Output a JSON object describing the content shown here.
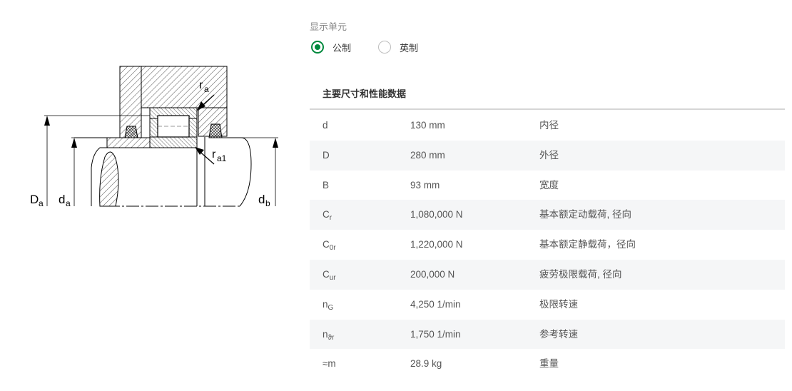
{
  "drawing": {
    "labels": {
      "Da_main": "D",
      "Da_sub": "a",
      "da_main": "d",
      "da_sub": "a",
      "db_main": "d",
      "db_sub": "b",
      "ra_main": "r",
      "ra_sub": "a",
      "ra1_main": "r",
      "ra1_sub": "a1"
    }
  },
  "units": {
    "heading": "显示单元",
    "options": [
      {
        "label": "公制",
        "selected": true
      },
      {
        "label": "英制",
        "selected": false
      }
    ],
    "accent_color": "#00893d"
  },
  "table": {
    "title": "主要尺寸和性能数据",
    "rows": [
      {
        "symbol": "d",
        "symbol_sub": "",
        "value": "130 mm",
        "desc": "内径"
      },
      {
        "symbol": "D",
        "symbol_sub": "",
        "value": "280 mm",
        "desc": "外径"
      },
      {
        "symbol": "B",
        "symbol_sub": "",
        "value": "93 mm",
        "desc": "宽度"
      },
      {
        "symbol": "C",
        "symbol_sub": "r",
        "value": "1,080,000 N",
        "desc": "基本额定动载荷, 径向"
      },
      {
        "symbol": "C",
        "symbol_sub": "0r",
        "value": "1,220,000 N",
        "desc": "基本额定静载荷，径向"
      },
      {
        "symbol": "C",
        "symbol_sub": "ur",
        "value": "200,000 N",
        "desc": "疲劳极限载荷, 径向"
      },
      {
        "symbol": "n",
        "symbol_sub": "G",
        "value": "4,250 1/min",
        "desc": "极限转速"
      },
      {
        "symbol": "n",
        "symbol_sub": "ϑr",
        "value": "1,750 1/min",
        "desc": "参考转速"
      },
      {
        "symbol": "≈m",
        "symbol_sub": "",
        "value": "28.9 kg",
        "desc": "重量"
      }
    ]
  }
}
